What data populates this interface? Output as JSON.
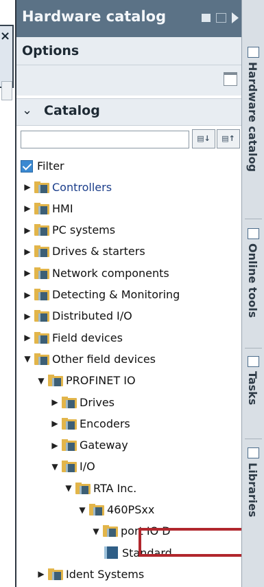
{
  "panel": {
    "title": "Hardware catalog"
  },
  "options": {
    "header": "Options"
  },
  "catalog": {
    "header": "Catalog",
    "search_placeholder": "",
    "filter_label": "Filter",
    "filter_checked": true
  },
  "tree": [
    {
      "label": "Controllers",
      "depth": 0,
      "expanded": false,
      "selected": true
    },
    {
      "label": "HMI",
      "depth": 0,
      "expanded": false
    },
    {
      "label": "PC systems",
      "depth": 0,
      "expanded": false
    },
    {
      "label": "Drives & starters",
      "depth": 0,
      "expanded": false
    },
    {
      "label": "Network components",
      "depth": 0,
      "expanded": false
    },
    {
      "label": "Detecting & Monitoring",
      "depth": 0,
      "expanded": false
    },
    {
      "label": "Distributed I/O",
      "depth": 0,
      "expanded": false
    },
    {
      "label": "Field devices",
      "depth": 0,
      "expanded": false
    },
    {
      "label": "Other field devices",
      "depth": 0,
      "expanded": true
    },
    {
      "label": "PROFINET IO",
      "depth": 1,
      "expanded": true
    },
    {
      "label": "Drives",
      "depth": 2,
      "expanded": false
    },
    {
      "label": "Encoders",
      "depth": 2,
      "expanded": false
    },
    {
      "label": "Gateway",
      "depth": 2,
      "expanded": false
    },
    {
      "label": "I/O",
      "depth": 2,
      "expanded": true
    },
    {
      "label": "RTA Inc.",
      "depth": 3,
      "expanded": true
    },
    {
      "label": "460PSxx",
      "depth": 4,
      "expanded": true
    },
    {
      "label": "port IO D",
      "depth": 5,
      "expanded": true
    },
    {
      "label": "Standard",
      "depth": 6,
      "leaf": true
    },
    {
      "label": "Ident Systems",
      "depth": 1,
      "expanded": false
    }
  ],
  "side_tabs": [
    "Hardware catalog",
    "Online tools",
    "Tasks",
    "Libraries"
  ],
  "colors": {
    "titlebar": "#5b7286",
    "highlight": "#b1272d",
    "selected_text": "#1a3d8a"
  }
}
